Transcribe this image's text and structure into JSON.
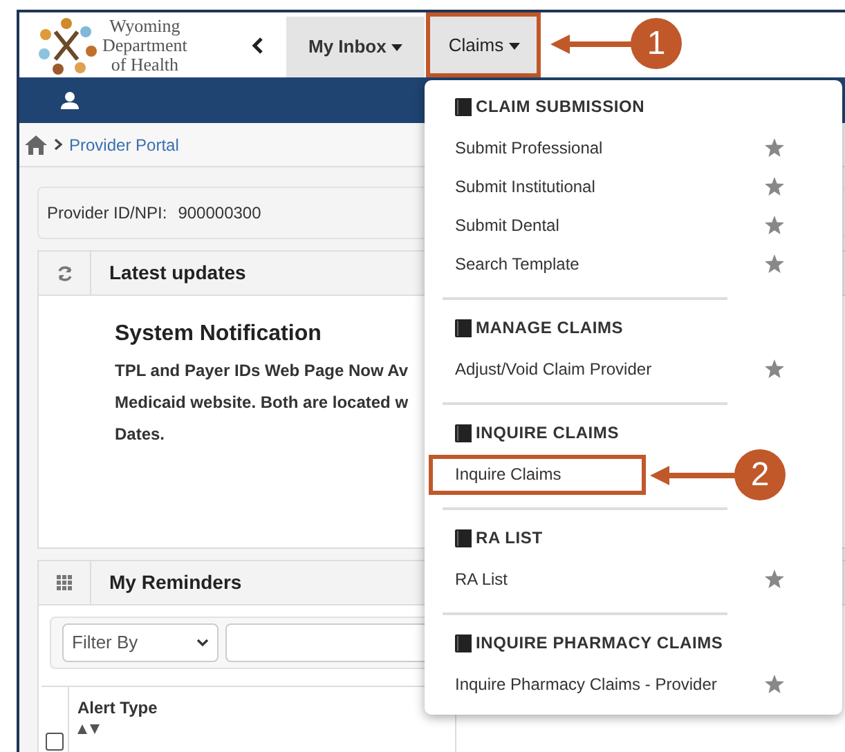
{
  "logo": {
    "lines": [
      "Wyoming",
      "Department",
      "of Health"
    ]
  },
  "nav_tabs": [
    {
      "label": "My Inbox",
      "selected": false
    },
    {
      "label": "Claims",
      "selected": true
    }
  ],
  "breadcrumb": [
    "Provider Portal"
  ],
  "provider": {
    "label": "Provider ID/NPI:",
    "value": "900000300"
  },
  "latest_updates": {
    "title": "Latest updates",
    "heading": "System Notification",
    "lines": [
      "TPL and Payer IDs Web Page Now Av",
      "Medicaid website. Both are located w",
      "Dates."
    ]
  },
  "reminders": {
    "title": "My Reminders",
    "filter": "Filter By",
    "columns": [
      "Alert Type"
    ],
    "select_all": {
      "checked": false
    }
  },
  "menu": [
    {
      "title": "CLAIM SUBMISSION",
      "items": [
        {
          "label": "Submit Professional",
          "favorite": true
        },
        {
          "label": "Submit Institutional",
          "favorite": true
        },
        {
          "label": "Submit Dental",
          "favorite": true
        },
        {
          "label": "Search Template",
          "favorite": true
        }
      ]
    },
    {
      "title": "MANAGE CLAIMS",
      "items": [
        {
          "label": "Adjust/Void Claim Provider",
          "favorite": true
        }
      ]
    },
    {
      "title": "INQUIRE CLAIMS",
      "items": [
        {
          "label": "Inquire Claims"
        }
      ]
    },
    {
      "title": "RA LIST",
      "items": [
        {
          "label": "RA List",
          "favorite": true
        }
      ]
    },
    {
      "title": "INQUIRE PHARMACY CLAIMS",
      "items": [
        {
          "label": "Inquire Pharmacy Claims - Provider",
          "favorite": true
        }
      ]
    }
  ],
  "callouts": [
    {
      "label": "1"
    },
    {
      "label": "2"
    }
  ]
}
